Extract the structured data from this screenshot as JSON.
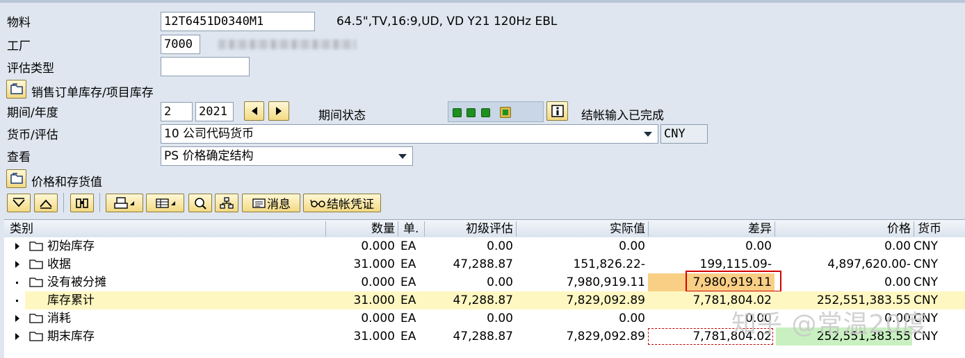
{
  "form": {
    "material": {
      "label": "物料",
      "value": "12T6451D0340M1",
      "description": "64.5\",TV,16:9,UD, VD Y21 120Hz EBL"
    },
    "plant": {
      "label": "工厂",
      "value": "7000"
    },
    "valuation_type": {
      "label": "评估类型",
      "value": ""
    },
    "sales_order_stock": {
      "label": "销售订单库存/项目库存"
    },
    "period_year": {
      "label": "期间/年度",
      "period": "2",
      "year": "2021"
    },
    "period_status": {
      "label": "期间状态",
      "text": "结帐输入已完成"
    },
    "currency_valuation": {
      "label": "货币/评估",
      "value": "10 公司代码货币",
      "currency": "CNY"
    },
    "view": {
      "label": "查看",
      "value": "PS 价格确定结构"
    },
    "price_and_inventory": {
      "label": "价格和存货值"
    }
  },
  "toolbar": {
    "message_label": "消息",
    "closing_doc_label": "结帐凭证"
  },
  "table": {
    "headers": {
      "category": "类别",
      "quantity": "数量",
      "unit": "单.",
      "initial": "初级评估",
      "actual": "实际值",
      "difference": "差异",
      "price": "价格",
      "currency": "货币"
    },
    "rows": [
      {
        "name": "初始库存",
        "quantity": "0.000",
        "unit": "EA",
        "initial": "0.00",
        "actual": "0.00",
        "difference": "0.00",
        "price": "0.00",
        "currency": "CNY"
      },
      {
        "name": "收据",
        "quantity": "31.000",
        "unit": "EA",
        "initial": "47,288.87",
        "actual": "151,826.22-",
        "difference": "199,115.09-",
        "price": "4,897,620.00-",
        "currency": "CNY"
      },
      {
        "name": "没有被分摊",
        "quantity": "0.000",
        "unit": "EA",
        "initial": "0.00",
        "actual": "7,980,919.11",
        "difference": "7,980,919.11",
        "price": "0.00",
        "currency": "CNY"
      },
      {
        "name": "库存累计",
        "quantity": "31.000",
        "unit": "EA",
        "initial": "47,288.87",
        "actual": "7,829,092.89",
        "difference": "7,781,804.02",
        "price": "252,551,383.55",
        "currency": "CNY"
      },
      {
        "name": "消耗",
        "quantity": "0.000",
        "unit": "EA",
        "initial": "0.00",
        "actual": "0.00",
        "difference": "0.00",
        "price": "0.00",
        "currency": "CNY"
      },
      {
        "name": "期末库存",
        "quantity": "31.000",
        "unit": "EA",
        "initial": "47,288.87",
        "actual": "7,829,092.89",
        "difference": "7,781,804.02",
        "price": "252,551,383.55",
        "currency": "CNY"
      }
    ]
  },
  "watermark": "知乎 @常温20度",
  "colors": {
    "background": "#dfe6ef",
    "highlight_row": "#fff7c2",
    "orange_cell": "#f9cf86",
    "green_cell": "#c8f0c0",
    "red_box": "#d40000",
    "status_green": "#1f8f1f"
  }
}
